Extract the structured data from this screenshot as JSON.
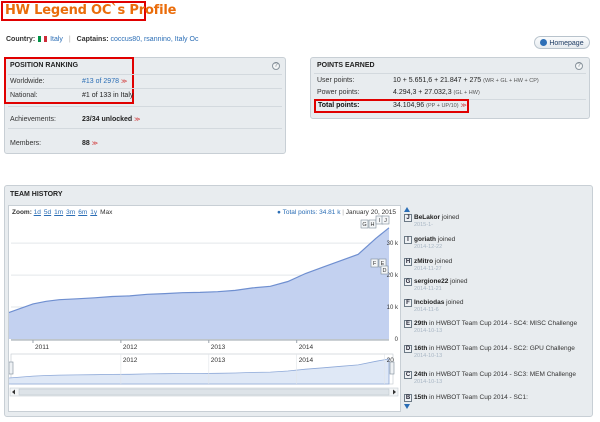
{
  "page": {
    "title": "HW Legend OC`s Profile"
  },
  "info": {
    "country_label": "Country:",
    "country_value": "Italy",
    "captains_label": "Captains:",
    "captains_value": "coccus80, rsannino, Italy Oc",
    "homepage_label": "Homepage"
  },
  "position_ranking": {
    "heading": "POSITION RANKING",
    "help": "?",
    "rows": [
      {
        "label": "Worldwide:",
        "value": "#13 of 2978"
      },
      {
        "label": "National:",
        "value": "#1 of 133 in Italy"
      },
      {
        "label": "Achievements:",
        "value": "23/34 unlocked"
      },
      {
        "label": "Members:",
        "value": "88"
      }
    ],
    "hwbot_mark": "≫"
  },
  "points_earned": {
    "heading": "POINTS EARNED",
    "help": "?",
    "user_label": "User points:",
    "user_value": "10 + 5.651,6 + 21.847 + 275",
    "user_note": "(WR + GL + HW + CP)",
    "power_label": "Power points:",
    "power_value": "4.294,3 + 27.032,3",
    "power_note": "(GL + HW)",
    "total_label": "Total points:",
    "total_value": "34.104,96",
    "total_note": "(PP + UP/10)"
  },
  "team_history": {
    "heading": "TEAM HISTORY",
    "zoom_label": "Zoom:",
    "zoom_options": [
      "1d",
      "5d",
      "1m",
      "3m",
      "6m",
      "1y",
      "Max"
    ],
    "legend_label": "Total points: 34.81 k",
    "date_label": "January 20, 2015",
    "flag_letters": [
      "G",
      "H",
      "I",
      "J",
      "F",
      "E",
      "D"
    ],
    "nav_years": [
      "2012",
      "2013",
      "2014",
      "20"
    ]
  },
  "chart_data": {
    "type": "area",
    "title": "",
    "series": [
      {
        "name": "Total points",
        "color": "#6f8fd0",
        "x": [
          2010.7,
          2011.0,
          2011.15,
          2011.3,
          2011.5,
          2011.7,
          2011.9,
          2012.1,
          2012.3,
          2012.5,
          2012.7,
          2012.9,
          2013.1,
          2013.3,
          2013.5,
          2013.7,
          2013.9,
          2014.1,
          2014.3,
          2014.5,
          2014.7,
          2014.9,
          2015.05
        ],
        "y": [
          8.0,
          11.0,
          11.8,
          12.3,
          12.6,
          12.9,
          13.3,
          13.5,
          14.0,
          14.2,
          14.5,
          14.6,
          14.8,
          15.2,
          16.0,
          16.5,
          18.0,
          20.5,
          22.5,
          24.5,
          26.5,
          31.5,
          34.81
        ]
      }
    ],
    "x_ticks": [
      "2011",
      "2012",
      "2013",
      "2014"
    ],
    "y_ticks": [
      "0",
      "10 k",
      "20 k",
      "30 k"
    ],
    "ylim": [
      0,
      36
    ],
    "xlim": [
      2010.75,
      2015.05
    ],
    "grid": true
  },
  "events": [
    {
      "flag": "J",
      "name": "BeLakor",
      "text": "joined",
      "date": "2015-1-"
    },
    {
      "flag": "I",
      "name": "goriath",
      "text": "joined",
      "date": "2014-12-22"
    },
    {
      "flag": "H",
      "name": "zMitro",
      "text": "joined",
      "date": "2014-11-27"
    },
    {
      "flag": "G",
      "name": "sergione22",
      "text": "joined",
      "date": "2014-11-21"
    },
    {
      "flag": "F",
      "name": "Incbiodas",
      "text": "joined",
      "date": "2014-11-6"
    },
    {
      "flag": "E",
      "name": "29th",
      "text": "in HWBOT Team Cup 2014 - SC4: MISC Challenge",
      "date": "2014-10-13"
    },
    {
      "flag": "D",
      "name": "16th",
      "text": "in HWBOT Team Cup 2014 - SC2: GPU Challenge",
      "date": "2014-10-13"
    },
    {
      "flag": "C",
      "name": "24th",
      "text": "in HWBOT Team Cup 2014 - SC3: MEM Challenge",
      "date": "2014-10-13"
    },
    {
      "flag": "B",
      "name": "15th",
      "text": "in HWBOT Team Cup 2014 - SC1:",
      "date": ""
    }
  ]
}
